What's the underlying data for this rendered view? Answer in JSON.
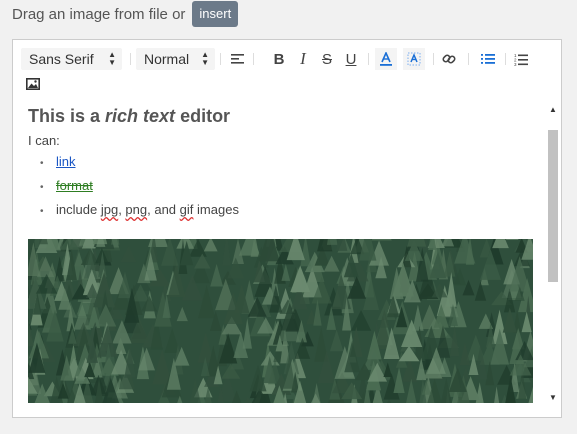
{
  "drop_label": "Drag an image from file or",
  "insert_label": "insert",
  "toolbar": {
    "font_select": "Sans Serif",
    "size_select": "Normal"
  },
  "content": {
    "title_pre": "This is a ",
    "title_em": "rich text",
    "title_post": " editor",
    "ican": "I can:",
    "items": {
      "link": "link",
      "format": "format",
      "include": "include",
      "jpg": "jpg",
      "png": "png",
      "and": ", and",
      "gif": "gif",
      "images": "images"
    }
  },
  "colors": {
    "link": "#1a56c4",
    "format": "#2e7d22",
    "insert_bg": "#6c7a89",
    "toolbar_active": "#1a6fd6"
  },
  "icons": [
    "align-left-icon",
    "bold-icon",
    "italic-icon",
    "strike-icon",
    "underline-icon",
    "text-color-icon",
    "background-color-icon",
    "link-icon",
    "bullet-list-icon",
    "numbered-list-icon",
    "image-icon"
  ]
}
